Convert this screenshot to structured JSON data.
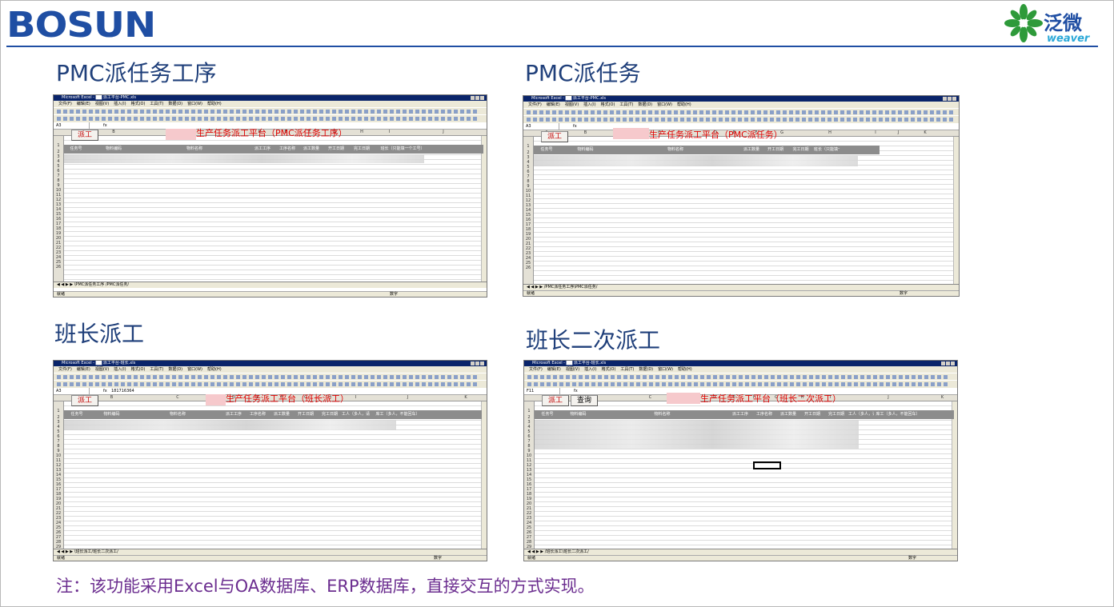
{
  "header": {
    "logo_text": "BOSUN",
    "partner_logo_cn": "泛微",
    "partner_logo_en": "weaver",
    "accent_color": "#1f4ea3"
  },
  "panels": [
    {
      "title": "PMC派任务工序",
      "window_title": "Microsoft Excel - ██ 派工平台-PMC.xls",
      "menu": [
        "文件(F)",
        "编辑(E)",
        "视图(V)",
        "插入(I)",
        "格式(O)",
        "工具(T)",
        "数据(D)",
        "窗口(W)",
        "帮助(H)"
      ],
      "name_box": "A3",
      "formula_value": "",
      "columns": [
        "A",
        "B",
        "C",
        "D",
        "E",
        "F",
        "G",
        "H",
        "I",
        "J",
        "K"
      ],
      "buttons": [
        "派工"
      ],
      "platform_title": "生产任务派工平台（PMC派任务工序）",
      "headers": [
        "任务号",
        "物料编码",
        "物料名称",
        "派工工序",
        "工序名称",
        "派工数量",
        "开工日期",
        "完工日期",
        "班长（只能填一个工号）"
      ],
      "sheet_tabs": "◀ ◀ ▶ ▶ \\PMC派任务工序 /PMC派任务/",
      "status_left": "就绪",
      "status_right": "数字"
    },
    {
      "title": "PMC派任务",
      "window_title": "Microsoft Excel - ██ 派工平台-PMC.xls",
      "menu": [
        "文件(F)",
        "编辑(E)",
        "视图(V)",
        "插入(I)",
        "格式(O)",
        "工具(T)",
        "数据(D)",
        "窗口(W)",
        "帮助(H)"
      ],
      "name_box": "A3",
      "formula_value": "",
      "columns": [
        "A",
        "B",
        "C",
        "D",
        "E",
        "F",
        "G",
        "H",
        "I",
        "J",
        "K"
      ],
      "buttons": [
        "派工"
      ],
      "platform_title": "生产任务派工平台（PMC派任务）",
      "headers": [
        "任务号",
        "物料编码",
        "物料名称",
        "派工数量",
        "开工日期",
        "完工日期",
        "班长（只能填一个工号）"
      ],
      "sheet_tabs": "◀ ◀ ▶ ▶ /PMC派任务工序\\PMC派任务/",
      "status_left": "就绪",
      "status_right": "数字"
    },
    {
      "title": "班长派工",
      "window_title": "Microsoft Excel - ██ 派工平台-班长.xls",
      "menu": [
        "文件(F)",
        "编辑(E)",
        "视图(V)",
        "插入(I)",
        "格式(O)",
        "工具(T)",
        "数据(D)",
        "窗口(W)",
        "帮助(H)"
      ],
      "name_box": "A3",
      "formula_value": "181716364",
      "columns": [
        "A",
        "B",
        "C",
        "D",
        "E",
        "F",
        "G",
        "H",
        "I",
        "J",
        "K"
      ],
      "buttons": [
        "派工"
      ],
      "platform_title": "生产任务派工平台（班长派工）",
      "headers": [
        "任务号",
        "物料编码",
        "物料名称",
        "派工工序",
        "工序名称",
        "派工数量",
        "开工日期",
        "完工日期",
        "工人（多人，请勾填开）",
        "库工（多人，不能回车）"
      ],
      "sheet_tabs": "◀ ◀ ▶ ▶ \\班长派工/班长二次派工/",
      "status_left": "就绪",
      "status_right": "数字"
    },
    {
      "title": "班长二次派工",
      "window_title": "Microsoft Excel - ██ 派工平台-班长.xls",
      "menu": [
        "文件(F)",
        "编辑(E)",
        "视图(V)",
        "插入(I)",
        "格式(O)",
        "工具(T)",
        "数据(D)",
        "窗口(W)",
        "帮助(H)"
      ],
      "name_box": "F11",
      "formula_value": "",
      "columns": [
        "A",
        "B",
        "C",
        "D",
        "E",
        "F",
        "G",
        "H",
        "I",
        "J",
        "K"
      ],
      "buttons": [
        "派工",
        "查询"
      ],
      "platform_title": "生产任务派工平台（班长二次派工）",
      "headers": [
        "任务号",
        "物料编码",
        "物料名称",
        "派工工序",
        "工序名称",
        "派工数量",
        "开工日期",
        "完工日期",
        "工人（多人，请勾填开）",
        "库工（多人，不能回车）"
      ],
      "sheet_tabs": "◀ ◀ ▶ ▶ /班长派工\\班长二次派工/",
      "status_left": "就绪",
      "status_right": "数字"
    }
  ],
  "note": "注：该功能采用Excel与OA数据库、ERP数据库，直接交互的方式实现。"
}
